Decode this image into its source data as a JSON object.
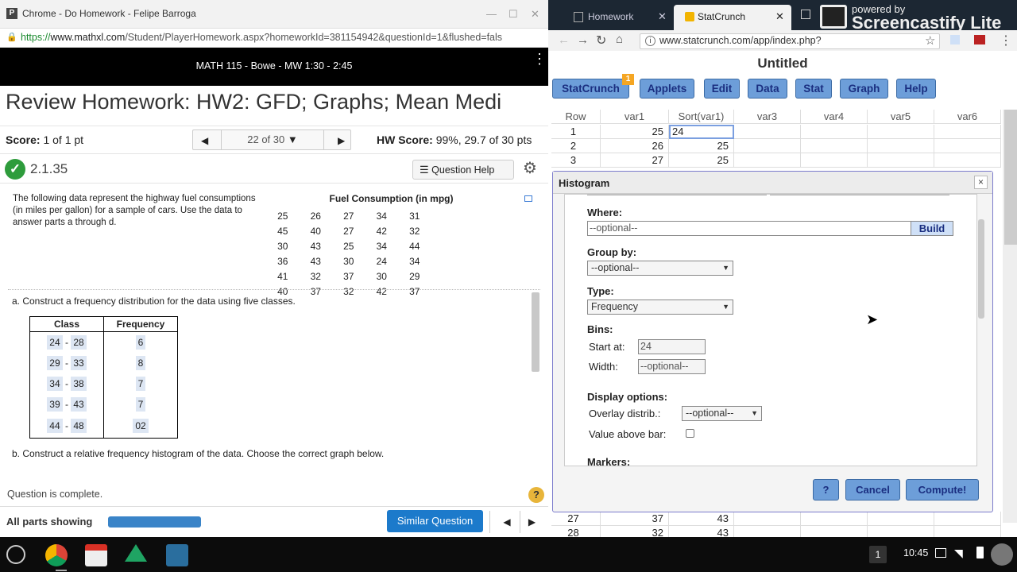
{
  "left_window": {
    "title": "Chrome - Do Homework - Felipe Barroga",
    "url_https": "https://",
    "url_domain": "www.mathxl.com",
    "url_rest": "/Student/PlayerHomework.aspx?homeworkId=381154942&questionId=1&flushed=fals",
    "course": "MATH 115 - Bowe - MW 1:30 - 2:45",
    "page_title": "Review Homework: HW2: GFD; Graphs; Mean Medi",
    "score_label": "Score:",
    "score_value": "1 of 1 pt",
    "question_nav": "22 of 30",
    "hw_score_label": "HW Score:",
    "hw_score_value": "99%, 29.7 of 30 pts",
    "question_id": "2.1.35",
    "question_help": "Question Help",
    "question_text": "The following data represent the highway fuel consumptions (in miles per gallon) for a sample of cars. Use the data to answer parts a through d.",
    "data_title": "Fuel Consumption (in mpg)",
    "data_values": [
      "25",
      "26",
      "27",
      "34",
      "31",
      "45",
      "40",
      "27",
      "42",
      "32",
      "30",
      "43",
      "25",
      "34",
      "44",
      "36",
      "43",
      "30",
      "24",
      "34",
      "41",
      "32",
      "37",
      "30",
      "29",
      "40",
      "37",
      "32",
      "42",
      "37"
    ],
    "part_a": "a. Construct a frequency distribution for the data using five classes.",
    "table_headers": [
      "Class",
      "Frequency"
    ],
    "table_rows": [
      {
        "lo": "24",
        "hi": "28",
        "freq": "6"
      },
      {
        "lo": "29",
        "hi": "33",
        "freq": "8"
      },
      {
        "lo": "34",
        "hi": "38",
        "freq": "7"
      },
      {
        "lo": "39",
        "hi": "43",
        "freq": "7"
      },
      {
        "lo": "44",
        "hi": "48",
        "freq": "02"
      }
    ],
    "dash": "-",
    "part_b": "b. Construct a relative frequency histogram of the data. Choose the correct graph below.",
    "question_complete": "Question is complete.",
    "all_parts": "All parts showing",
    "similar_question": "Similar Question",
    "help_glyph": "?"
  },
  "right_window": {
    "tabs": [
      "Homework",
      "StatCrunch"
    ],
    "address": "www.statcrunch.com/app/index.php?",
    "watermark_top": "powered by",
    "watermark_bottom": "Screencastify Lite",
    "doc_title": "Untitled",
    "menu": [
      "StatCrunch",
      "Applets",
      "Edit",
      "Data",
      "Stat",
      "Graph",
      "Help"
    ],
    "menu_badge": "1",
    "grid_headers": [
      "Row",
      "var1",
      "Sort(var1)",
      "var3",
      "var4",
      "var5",
      "var6"
    ],
    "grid_rows_top": [
      {
        "row": "1",
        "var1": "25",
        "sort": "24"
      },
      {
        "row": "2",
        "var1": "26",
        "sort": "25"
      },
      {
        "row": "3",
        "var1": "27",
        "sort": "25"
      }
    ],
    "grid_rows_bottom": [
      {
        "row": "27",
        "var1": "37",
        "sort": "43"
      },
      {
        "row": "28",
        "var1": "32",
        "sort": "43"
      }
    ],
    "dialog": {
      "title": "Histogram",
      "close": "×",
      "where_label": "Where:",
      "where_placeholder": "--optional--",
      "build": "Build",
      "group_by_label": "Group by:",
      "group_by_value": "--optional--",
      "type_label": "Type:",
      "type_value": "Frequency",
      "bins_label": "Bins:",
      "start_at_label": "Start at:",
      "start_at_value": "24",
      "width_label": "Width:",
      "width_value": "--optional--",
      "display_label": "Display options:",
      "overlay_label": "Overlay distrib.:",
      "overlay_value": "--optional--",
      "value_above_label": "Value above bar:",
      "markers_label": "Markers:",
      "help_button": "?",
      "cancel_button": "Cancel",
      "compute_button": "Compute!"
    }
  },
  "taskbar": {
    "notification_count": "1",
    "time": "10:45"
  }
}
